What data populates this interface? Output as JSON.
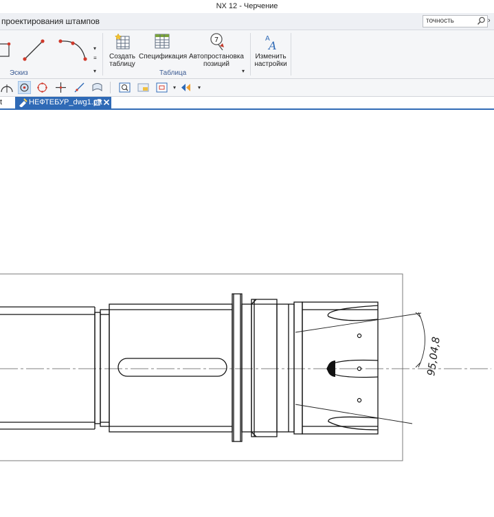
{
  "window": {
    "title": "NX 12 - Черчение"
  },
  "menubar": {
    "label": "проектирования штампов",
    "search_value": "точность",
    "more": "›"
  },
  "ribbon": {
    "groups": {
      "sketch": "Эскиз",
      "table": "Таблица"
    },
    "buttons": {
      "create_table": "Создать таблицу",
      "specification": "Спецификация",
      "auto_balloon": "Автопростановка позиций",
      "change_settings": "Изменить настройки"
    }
  },
  "tabs": {
    "previous": "t",
    "active": "НЕФТЕБУР_dwg1.prt"
  },
  "drawing": {
    "dimension_text": "95,04,8"
  },
  "colors": {
    "accent": "#2f6ab6",
    "sketch_red": "#d03a2c",
    "ribbon_bg": "#f5f6f8"
  }
}
